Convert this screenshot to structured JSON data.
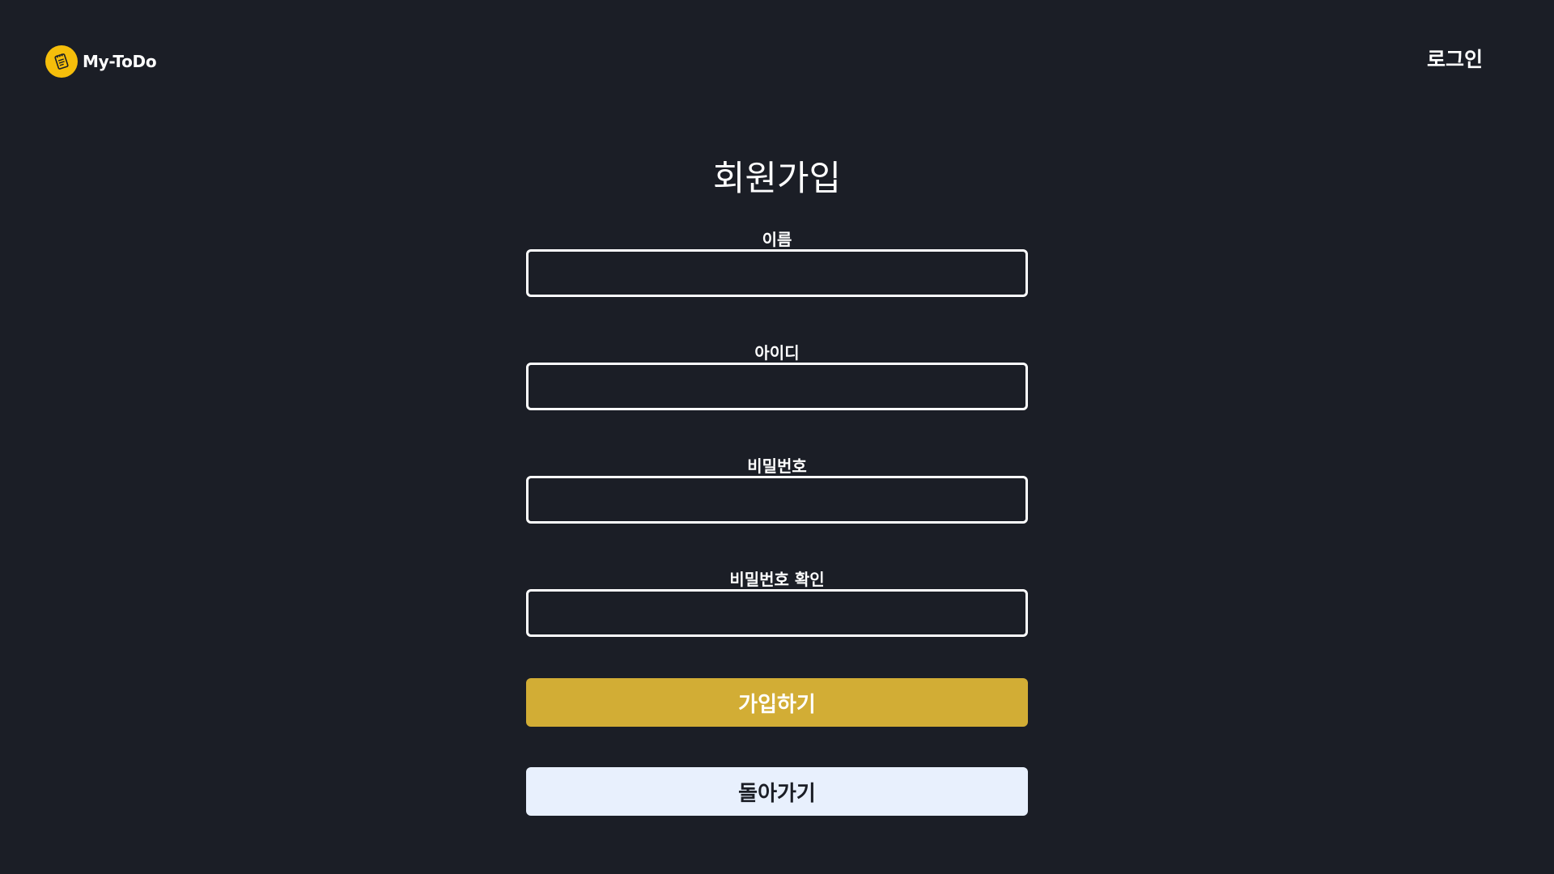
{
  "header": {
    "logo_text": "My-ToDo",
    "login_link": "로그인"
  },
  "form": {
    "title": "회원가입",
    "fields": [
      {
        "label": "이름",
        "value": ""
      },
      {
        "label": "아이디",
        "value": ""
      },
      {
        "label": "비밀번호",
        "value": ""
      },
      {
        "label": "비밀번호 확인",
        "value": ""
      }
    ],
    "submit_label": "가입하기",
    "back_label": "돌아가기"
  },
  "colors": {
    "background": "#1b1e26",
    "brand": "#f5be0b",
    "primary_button": "#d2ad35",
    "secondary_button": "#e8f0fd"
  },
  "icons": {
    "logo": "notepad-icon"
  }
}
